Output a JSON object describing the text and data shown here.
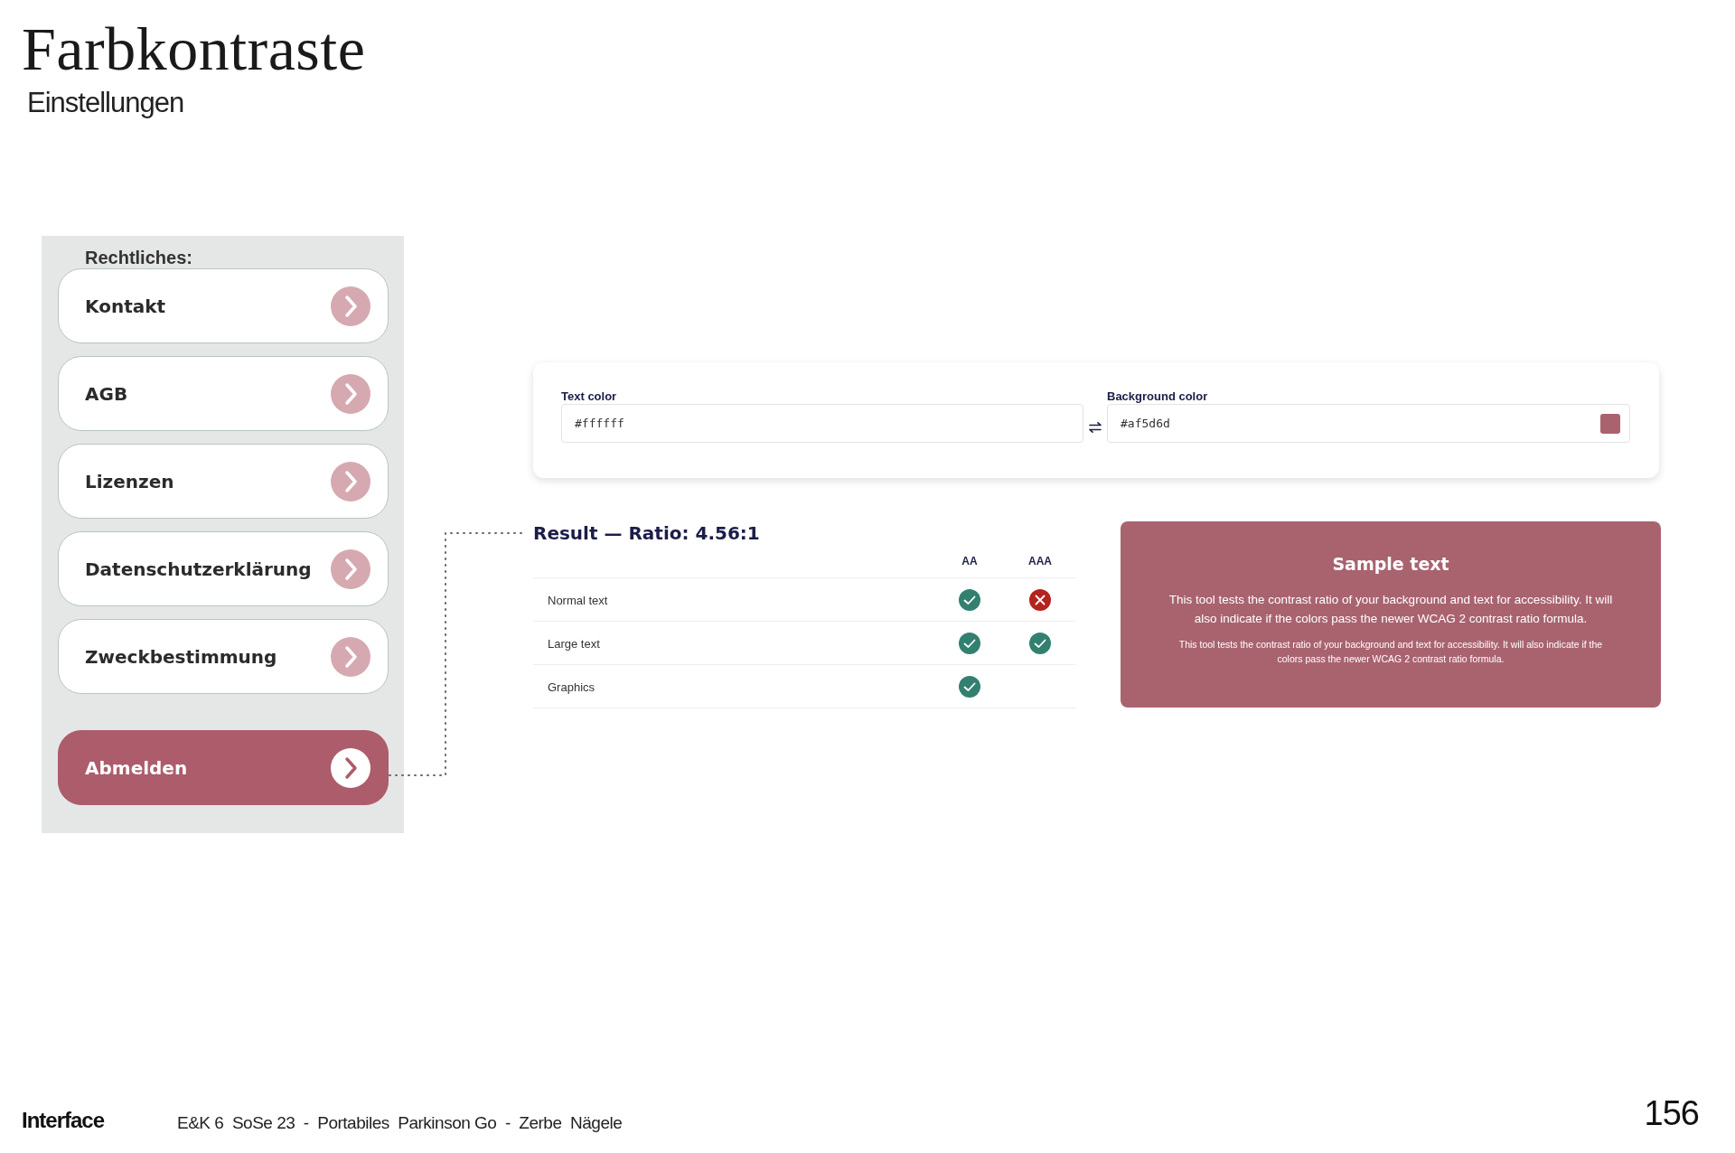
{
  "title": "Farbkontraste",
  "subtitle": "Einstellungen",
  "settings_panel": {
    "heading": "Rechtliches:",
    "items": [
      {
        "label": "Kontakt",
        "kind": "link"
      },
      {
        "label": "AGB",
        "kind": "link"
      },
      {
        "label": "Lizenzen",
        "kind": "link"
      },
      {
        "label": "Datenschutzerklärung",
        "kind": "link"
      },
      {
        "label": "Zweckbestimmung",
        "kind": "link"
      },
      {
        "label": "Abmelden",
        "kind": "logout"
      }
    ]
  },
  "contrast_checker": {
    "text_color": {
      "label": "Text color",
      "value": "#ffffff"
    },
    "background_color": {
      "label": "Background color",
      "value": "#af5d6d"
    }
  },
  "result": {
    "title": "Result — Ratio: 4.56:1",
    "columns": [
      "AA",
      "AAA"
    ],
    "rows": [
      {
        "label": "Normal text",
        "results": [
          {
            "passed": true
          },
          {
            "passed": false
          }
        ]
      },
      {
        "label": "Large text",
        "results": [
          {
            "passed": true
          },
          {
            "passed": true
          }
        ]
      },
      {
        "label": "Graphics",
        "results": [
          {
            "passed": true
          }
        ]
      }
    ]
  },
  "sample": {
    "heading": "Sample text",
    "large_text": "This tool tests the contrast ratio of your background and text for accessibility. It will also indicate if the colors pass the newer WCAG 2 contrast ratio formula.",
    "small_text": "This tool tests the contrast ratio of your background and text for accessibility. It will also indicate if the colors pass the newer WCAG 2 contrast ratio formula."
  },
  "footer": {
    "section": "Interface",
    "meta": "E&K 6  SoSe 23  -  Portabiles  Parkinson Go  -  Zerbe  Nägele",
    "page_number": "156"
  }
}
